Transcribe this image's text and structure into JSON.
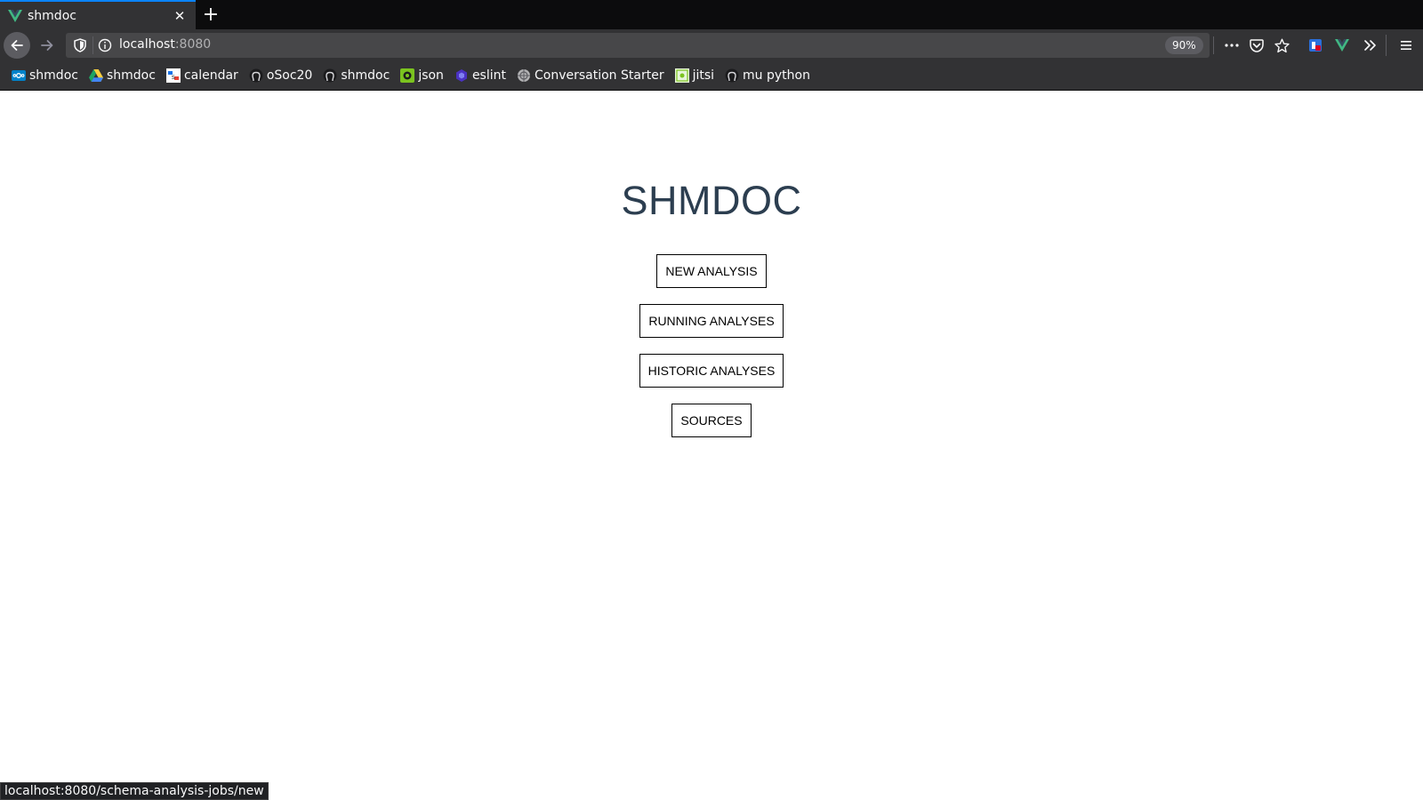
{
  "tab": {
    "title": "shmdoc",
    "favicon": "vue-icon"
  },
  "navbar": {
    "url_host": "localhost",
    "url_port": ":8080",
    "zoom": "90%"
  },
  "bookmarks": [
    {
      "label": "shmdoc",
      "icon": "nextcloud-icon"
    },
    {
      "label": "shmdoc",
      "icon": "google-drive-icon"
    },
    {
      "label": "calendar",
      "icon": "calendar-icon"
    },
    {
      "label": "oSoc20",
      "icon": "github-icon"
    },
    {
      "label": "shmdoc",
      "icon": "github-icon"
    },
    {
      "label": "json",
      "icon": "json-icon"
    },
    {
      "label": "eslint",
      "icon": "eslint-icon"
    },
    {
      "label": "Conversation Starter",
      "icon": "globe-icon"
    },
    {
      "label": "jitsi",
      "icon": "jitsi-icon"
    },
    {
      "label": "mu python",
      "icon": "github-icon"
    }
  ],
  "page": {
    "title": "SHMDOC",
    "buttons": {
      "new_analysis": "NEW ANALYSIS",
      "running_analyses": "RUNNING ANALYSES",
      "historic_analyses": "HISTORIC ANALYSES",
      "sources": "SOURCES"
    }
  },
  "statusbar": {
    "link": "localhost:8080/schema-analysis-jobs/new"
  },
  "colors": {
    "title": "#2c3e50",
    "vue_green": "#41b883",
    "tab_accent": "#0a84ff"
  }
}
